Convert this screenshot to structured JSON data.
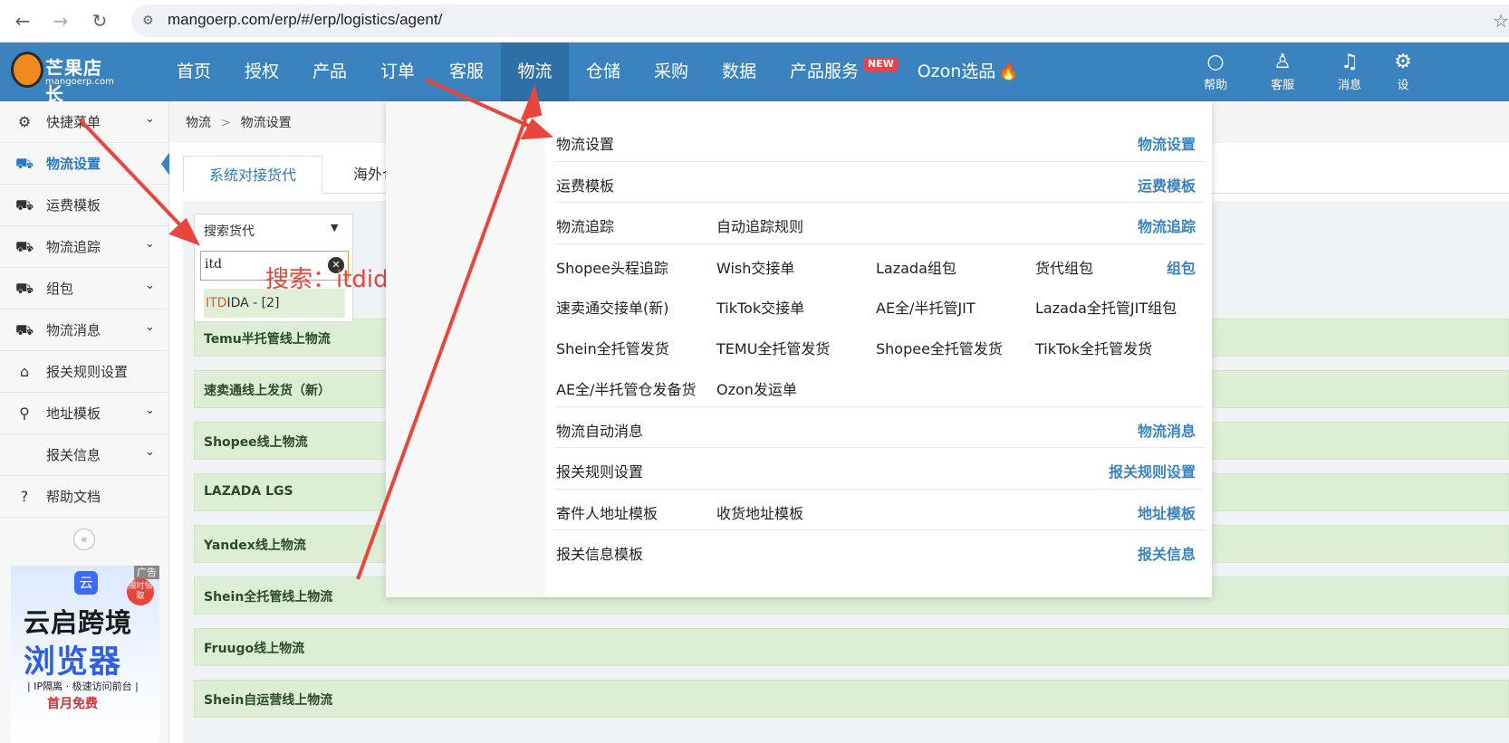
{
  "browser": {
    "url": "mangoerp.com/erp/#/erp/logistics/agent/"
  },
  "logo": {
    "name_cn": "芒果店长",
    "name_en": "mangoerp.com"
  },
  "topnav": {
    "items": [
      "首页",
      "授权",
      "产品",
      "订单",
      "客服",
      "物流",
      "仓储",
      "采购",
      "数据",
      "产品服务",
      "Ozon选品"
    ],
    "new_badge": "NEW",
    "tools": [
      "帮助",
      "客服",
      "消息",
      "设"
    ]
  },
  "sidebar": {
    "items": [
      {
        "label": "快捷菜单",
        "icon": "gear-icon"
      },
      {
        "label": "物流设置",
        "icon": "truck-icon"
      },
      {
        "label": "运费模板",
        "icon": "truck-icon"
      },
      {
        "label": "物流追踪",
        "icon": "truck-icon"
      },
      {
        "label": "组包",
        "icon": "truck-icon"
      },
      {
        "label": "物流消息",
        "icon": "truck-icon"
      },
      {
        "label": "报关规则设置",
        "icon": "bank-icon"
      },
      {
        "label": "地址模板",
        "icon": "location-icon"
      },
      {
        "label": "报关信息",
        "icon": ""
      },
      {
        "label": "帮助文档",
        "icon": "help-icon"
      }
    ]
  },
  "ad": {
    "tag": "广告",
    "badge": "限时领取",
    "line1": "云启跨境",
    "line2": "浏览器",
    "line3": "| IP隔离 · 极速访问前台 |",
    "line4": "首月免费"
  },
  "breadcrumb": {
    "root": "物流",
    "current": "物流设置"
  },
  "tabs": [
    "系统对接货代",
    "海外仓"
  ],
  "dropdown": {
    "label": "搜索货代",
    "input_value": "itd",
    "option_match": "ITD",
    "option_rest": "IDA - [2]"
  },
  "search_note": "搜索：itdida",
  "rows": [
    "Temu半托管线上物流",
    "速卖通线上发货（新）",
    "Shopee线上物流",
    "LAZADA LGS",
    "Yandex线上物流",
    "Shein全托管线上物流",
    "Fruugo线上物流",
    "Shein自运营线上物流"
  ],
  "mega_menu": {
    "categories": [
      "物流设置",
      "运费模板",
      "物流追踪",
      "组包",
      "物流消息",
      "报关规则设置",
      "地址模板",
      "报关信息"
    ],
    "wuliu_shezhi": [
      "物流设置"
    ],
    "yunfei": [
      "运费模板"
    ],
    "zhuizong": [
      "物流追踪",
      "自动追踪规则"
    ],
    "zubao": [
      "Shopee头程追踪",
      "Wish交接单",
      "Lazada组包",
      "货代组包",
      "速卖通交接单(新)",
      "TikTok交接单",
      "AE全/半托管JIT",
      "Lazada全托管JIT组包",
      "Shein全托管发货",
      "TEMU全托管发货",
      "Shopee全托管发货",
      "TikTok全托管发货",
      "AE全/半托管仓发备货",
      "Ozon发运单"
    ],
    "xiaoxi": [
      "物流自动消息"
    ],
    "baoguan_guize": [
      "报关规则设置"
    ],
    "dizhi": [
      "寄件人地址模板",
      "收货地址模板"
    ],
    "baoguan_xinxi": [
      "报关信息模板"
    ]
  },
  "colors": {
    "nav": "#3b83bf",
    "accent": "#2b78c2",
    "annotation": "#e8453c",
    "row_bg": "#dcefd4"
  }
}
